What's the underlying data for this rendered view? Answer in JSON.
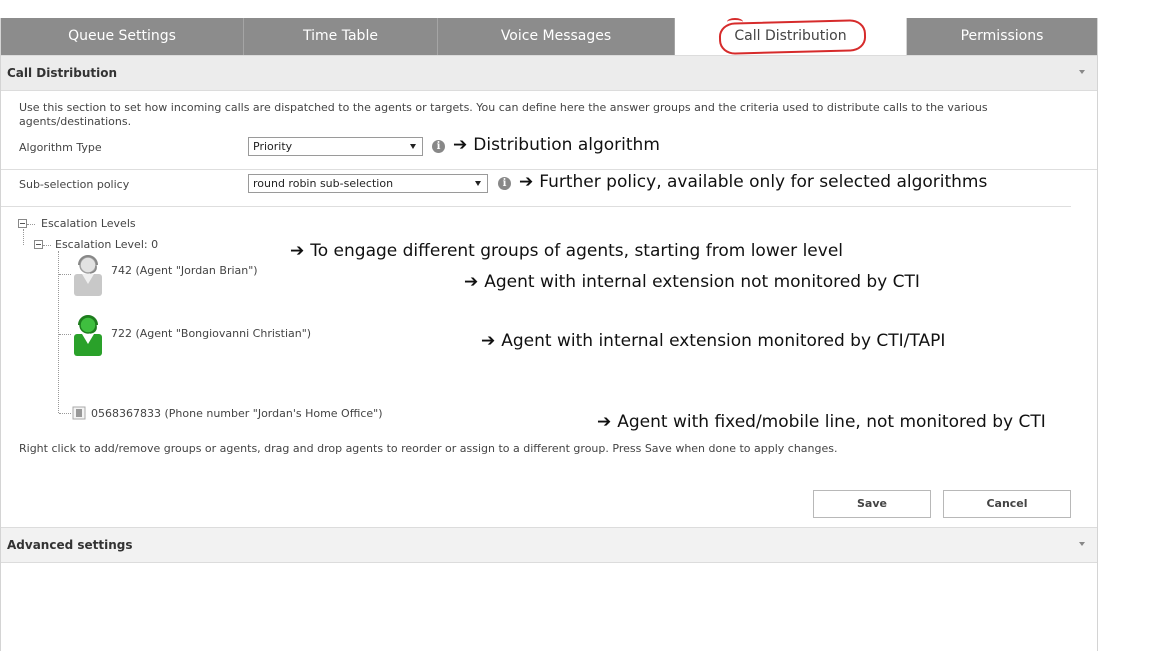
{
  "tabs": [
    {
      "label": "Queue Settings"
    },
    {
      "label": "Time Table"
    },
    {
      "label": "Voice Messages"
    },
    {
      "label": "Call Distribution"
    },
    {
      "label": "Permissions"
    }
  ],
  "section": {
    "title": "Call Distribution",
    "description": "Use this section to set how incoming calls are dispatched to the agents or targets. You can define here the answer groups and the criteria used to distribute calls to the various agents/destinations."
  },
  "algorithm": {
    "label": "Algorithm Type",
    "value": "Priority",
    "annotation": "Distribution algorithm"
  },
  "subselection": {
    "label": "Sub-selection policy",
    "value": "round robin sub-selection",
    "annotation": "Further policy, available only for selected algorithms"
  },
  "tree": {
    "root": "Escalation Levels",
    "level": "Escalation Level: 0",
    "level_annotation": "To engage different groups of agents, starting from lower level",
    "agents": [
      {
        "text": "742 (Agent \"Jordan Brian\")",
        "annotation": "Agent with internal extension not monitored by CTI"
      },
      {
        "text": "722 (Agent \"Bongiovanni Christian\")",
        "annotation": "Agent with internal extension monitored by CTI/TAPI"
      },
      {
        "text": "0568367833 (Phone number \"Jordan's Home Office\")",
        "annotation": "Agent with fixed/mobile line, not monitored by CTI"
      }
    ]
  },
  "help": "Right click to add/remove groups or agents, drag and drop agents to reorder or assign to a different group. Press Save when done to apply changes.",
  "buttons": {
    "save": "Save",
    "cancel": "Cancel"
  },
  "advanced": {
    "title": "Advanced settings"
  },
  "arrow_glyph": "➔",
  "info_glyph": "i",
  "colors": {
    "tab_bar": "#8c8c8c",
    "annotation_circle": "#d62b2b",
    "agent_active": "#2aa12a",
    "agent_inactive": "#c8c8c8"
  }
}
